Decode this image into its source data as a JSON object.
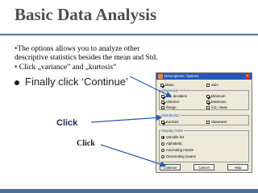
{
  "title": "Basic Data Analysis",
  "notes": [
    "•The options allows you to analyze other",
    "descriptive statistics besides the mean and Std.",
    "• Click „variance” and „kurtosis”"
  ],
  "bullet": "Finally click ‘Continue’",
  "click_labels": [
    "Click",
    "Click"
  ],
  "dialog": {
    "title": "Descriptives: Options",
    "mean": "Mean",
    "sum": "Sum",
    "dispersion": "Dispersion",
    "std_dev": "Std. deviation",
    "minimum": "Minimum",
    "variance": "Variance",
    "maximum": "Maximum",
    "range": "Range",
    "se_mean": "S.E. mean",
    "distribution": "Distribution",
    "kurtosis": "Kurtosis",
    "skewness": "Skewness",
    "display_order": "Display Order",
    "variable_list": "Variable list",
    "alphabetic": "Alphabetic",
    "ascending": "Ascending means",
    "descending": "Descending means",
    "buttons": [
      "Continue",
      "Cancel",
      "Help"
    ]
  },
  "colors": {
    "accent_line": "#4f6f97",
    "click_arrow": "#2456b8"
  }
}
